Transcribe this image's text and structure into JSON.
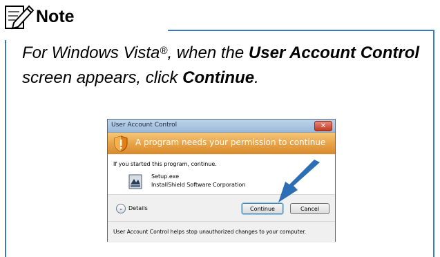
{
  "note": {
    "title": "Note",
    "icon": "pencil-note-icon",
    "text_prefix": "For Windows Vista",
    "registered": "®",
    "text_mid1": ", when the ",
    "bold1": "User Account Control",
    "text_mid2": " screen appears, click ",
    "bold2": "Continue",
    "text_end": "."
  },
  "dialog": {
    "title": "User Account Control",
    "close_label": "✕",
    "banner": "A program needs your permission to continue",
    "intro": "If you started this program, continue.",
    "program_name": "Setup.exe",
    "publisher": "InstallShield Software Corporation",
    "details_label": "Details",
    "continue_label": "Continue",
    "cancel_label": "Cancel",
    "footer": "User Account Control helps stop unauthorized changes to your computer."
  },
  "colors": {
    "rule": "#3a79be",
    "banner": "#e8a44a",
    "arrow": "#2d6eb5"
  }
}
